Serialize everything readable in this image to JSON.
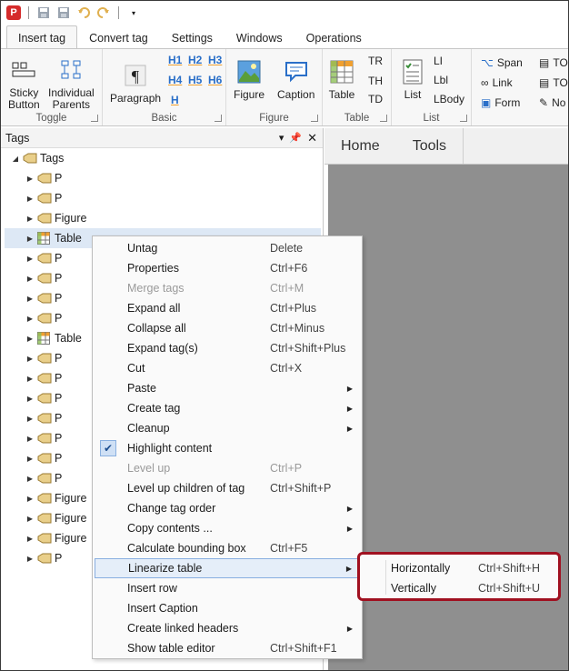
{
  "qat": {
    "logo": "P"
  },
  "ribbon_tabs": [
    "Insert tag",
    "Convert tag",
    "Settings",
    "Windows",
    "Operations"
  ],
  "ribbon": {
    "toggle": {
      "label": "Toggle",
      "sticky": "Sticky\nButton",
      "individual": "Individual\nParents"
    },
    "basic": {
      "label": "Basic",
      "paragraph": "Paragraph",
      "h1": "H1",
      "h2": "H2",
      "h3": "H3",
      "h4": "H4",
      "h5": "H5",
      "h6": "H6",
      "h": "H"
    },
    "figure": {
      "label": "Figure",
      "figure": "Figure",
      "caption": "Caption"
    },
    "table": {
      "label": "Table",
      "table": "Table",
      "tr": "TR",
      "th": "TH",
      "td": "TD"
    },
    "list": {
      "label": "List",
      "list": "List",
      "li": "LI",
      "lbl": "Lbl",
      "lbody": "LBody"
    },
    "misc": {
      "span": "Span",
      "link": "Link",
      "form": "Form",
      "toc1": "TO",
      "toc2": "TO",
      "note": "No"
    }
  },
  "tags_panel": {
    "title": "Tags",
    "root": "Tags",
    "items": [
      "P",
      "P",
      "Figure",
      "Table",
      "P",
      "P",
      "P",
      "P",
      "Table",
      "P",
      "P",
      "P",
      "P",
      "P",
      "P",
      "P",
      "Figure",
      "Figure",
      "Figure",
      "P"
    ]
  },
  "doc_tabs": [
    "Home",
    "Tools"
  ],
  "context_menu": [
    {
      "label": "Untag",
      "shortcut": "Delete"
    },
    {
      "label": "Properties",
      "shortcut": "Ctrl+F6"
    },
    {
      "label": "Merge tags",
      "shortcut": "Ctrl+M"
    },
    {
      "label": "Expand all",
      "shortcut": "Ctrl+Plus"
    },
    {
      "label": "Collapse all",
      "shortcut": "Ctrl+Minus"
    },
    {
      "label": "Expand tag(s)",
      "shortcut": "Ctrl+Shift+Plus"
    },
    {
      "label": "Cut",
      "shortcut": "Ctrl+X"
    },
    {
      "label": "Paste",
      "shortcut": ""
    },
    {
      "label": "Create tag",
      "shortcut": ""
    },
    {
      "label": "Cleanup",
      "shortcut": ""
    },
    {
      "label": "Highlight content",
      "shortcut": ""
    },
    {
      "label": "Level up",
      "shortcut": "Ctrl+P"
    },
    {
      "label": "Level up children of tag",
      "shortcut": "Ctrl+Shift+P"
    },
    {
      "label": "Change tag order",
      "shortcut": ""
    },
    {
      "label": "Copy contents ...",
      "shortcut": ""
    },
    {
      "label": "Calculate bounding box",
      "shortcut": "Ctrl+F5"
    },
    {
      "label": "Linearize table",
      "shortcut": ""
    },
    {
      "label": "Insert row",
      "shortcut": ""
    },
    {
      "label": "Insert Caption",
      "shortcut": ""
    },
    {
      "label": "Create linked headers",
      "shortcut": ""
    },
    {
      "label": "Show table editor",
      "shortcut": "Ctrl+Shift+F1"
    }
  ],
  "submenu": [
    {
      "label": "Horizontally",
      "shortcut": "Ctrl+Shift+H"
    },
    {
      "label": "Vertically",
      "shortcut": "Ctrl+Shift+U"
    }
  ],
  "colors": {
    "accent": "#2a6fc8",
    "highlight_border": "#a01020",
    "doc_bg": "#8f8f8f"
  }
}
